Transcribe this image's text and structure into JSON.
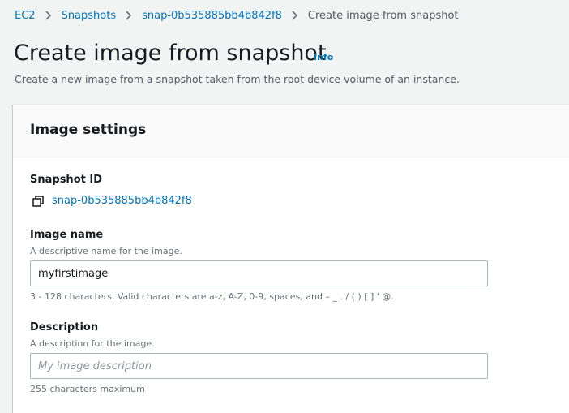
{
  "breadcrumb": {
    "items": [
      "EC2",
      "Snapshots",
      "snap-0b535885bb4b842f8"
    ],
    "current": "Create image from snapshot"
  },
  "page": {
    "title": "Create image from snapshot",
    "info_label": "Info",
    "subtitle": "Create a new image from a snapshot taken from the root device volume of an instance."
  },
  "panel": {
    "title": "Image settings"
  },
  "snapshot": {
    "label": "Snapshot ID",
    "value": "snap-0b535885bb4b842f8"
  },
  "image_name": {
    "label": "Image name",
    "description": "A descriptive name for the image.",
    "value": "myfirstimage",
    "constraint": "3 - 128 characters. Valid characters are a-z, A-Z, 0-9, spaces, and – _ . / ( ) [ ] ' @."
  },
  "description_field": {
    "label": "Description",
    "description": "A description for the image.",
    "value": "",
    "placeholder": "My image description",
    "constraint": "255 characters maximum"
  },
  "colors": {
    "link": "#0073bb",
    "background": "#f2f3f3",
    "text": "#16191f"
  },
  "icons": {
    "breadcrumb_separator": "chevron-right-icon",
    "copy": "copy-icon"
  }
}
